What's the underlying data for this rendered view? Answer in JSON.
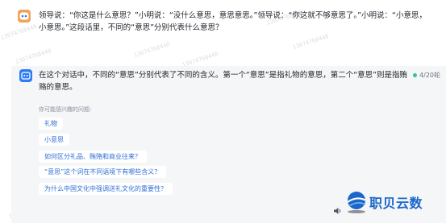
{
  "user_message": {
    "avatar_icon": "robot-face-icon",
    "text": "领导说：“你这是什么意思？”小明说：“没什么意思，意思意思。”领导说：“你这就不够意思了。”小明说：“小意思，小意思。”这段话里，不同的“意思”分别代表什么意思？"
  },
  "ai_response": {
    "avatar_icon": "ai-assistant-icon",
    "text": "在这个对话中，不同的“意思”分别代表了不同的含义。第一个“意思”是指礼物的意思，第二个“意思”则是指贿赂的意思。",
    "round_badge": "4/20轮",
    "round_dot_color": "#34c38f"
  },
  "suggestions": {
    "title": "你可能感兴趣的问题:",
    "items": [
      "礼物",
      "小意思",
      "如何区分礼品、贿赂和商业往来？",
      "“意思”这个词在不同语境下有哪些含义？",
      "为什么中国文化中强调送礼文化的重要性？"
    ]
  },
  "brand": {
    "name": "职贝云数",
    "color": "#1a66c9"
  },
  "colors": {
    "user_avatar": "#f4a259",
    "ai_avatar": "#2f7bf5",
    "suggestion_text": "#2f6fd6",
    "panel_bg": "#f5f6f8"
  }
}
